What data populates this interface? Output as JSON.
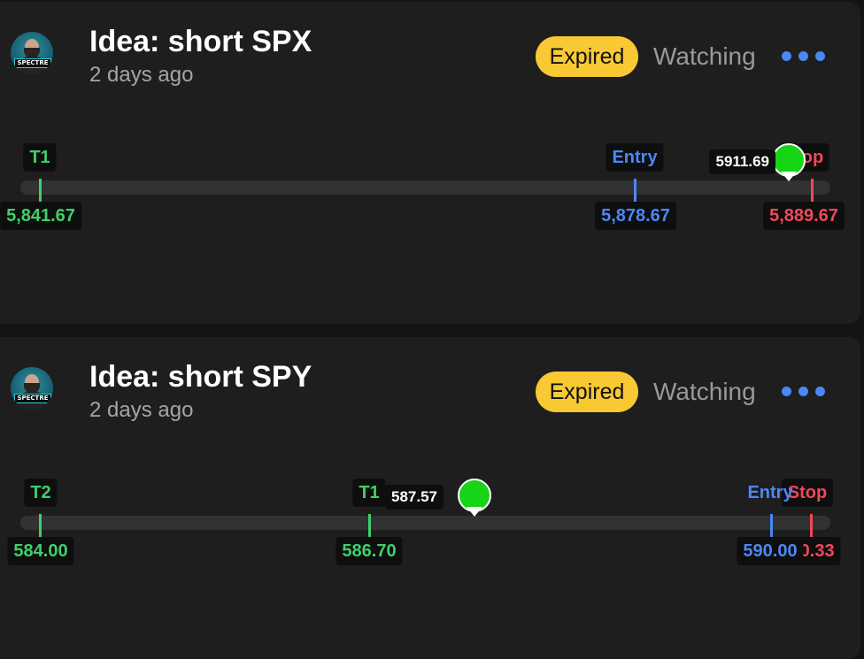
{
  "ideas": [
    {
      "title": "Idea: short SPX",
      "time": "2 days ago",
      "status": "Expired",
      "watch_label": "Watching",
      "current_price": "5911.69",
      "targets": [
        {
          "label": "T1",
          "value": "5,841.67"
        }
      ],
      "entry": {
        "label": "Entry",
        "value": "5,878.67"
      },
      "stop": {
        "label": "Stop",
        "value": "5,889.67"
      }
    },
    {
      "title": "Idea: short SPY",
      "time": "2 days ago",
      "status": "Expired",
      "watch_label": "Watching",
      "current_price": "587.57",
      "targets": [
        {
          "label": "T2",
          "value": "584.00"
        },
        {
          "label": "T1",
          "value": "586.70"
        }
      ],
      "entry": {
        "label": "Entry",
        "value": "590.00"
      },
      "stop": {
        "label": "Stop",
        "value": "590.33"
      }
    }
  ],
  "avatar_text": "SPECTRE",
  "colors": {
    "target": "#3ed06a",
    "entry": "#4a88f5",
    "stop": "#f0485a",
    "expired_badge": "#f8c932",
    "current_marker": "#16d416"
  },
  "icons": {
    "more": "more-horizontal-icon"
  }
}
